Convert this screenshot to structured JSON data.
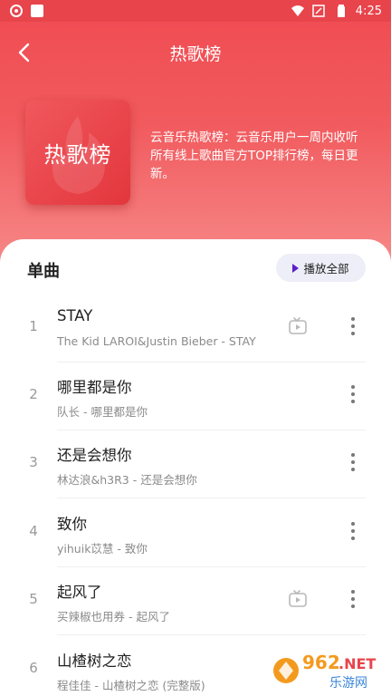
{
  "status_bar": {
    "time": "4:25"
  },
  "header": {
    "title": "热歌榜"
  },
  "cover": {
    "text": "热歌榜"
  },
  "description": "云音乐热歌榜：云音乐用户一周内收听所有线上歌曲官方TOP排行榜，每日更新。",
  "section": {
    "title": "单曲",
    "play_all_label": "播放全部"
  },
  "songs": [
    {
      "rank": "1",
      "title": "STAY",
      "subtitle": "The Kid LAROI&Justin Bieber - STAY",
      "has_mv": true
    },
    {
      "rank": "2",
      "title": "哪里都是你",
      "subtitle": "队长 - 哪里都是你",
      "has_mv": false
    },
    {
      "rank": "3",
      "title": "还是会想你",
      "subtitle": "林达浪&h3R3 - 还是会想你",
      "has_mv": false
    },
    {
      "rank": "4",
      "title": "致你",
      "subtitle": "yihuik苡慧 - 致你",
      "has_mv": false
    },
    {
      "rank": "5",
      "title": "起风了",
      "subtitle": "买辣椒也用券 - 起风了",
      "has_mv": true
    },
    {
      "rank": "6",
      "title": "山楂树之恋",
      "subtitle": "程佳佳 - 山楂树之恋 (完整版)",
      "has_mv": false
    }
  ],
  "watermark": {
    "brand": "962",
    "domain": ".NET",
    "site": "乐游网"
  },
  "colors": {
    "header_red": "#ef4b51",
    "accent_purple": "#5b21c9",
    "pill_bg": "#eeeef8"
  }
}
